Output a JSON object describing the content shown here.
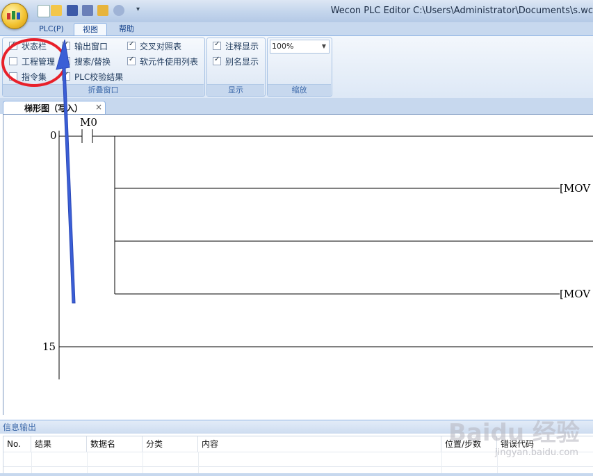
{
  "window": {
    "title": "Wecon PLC Editor  C:\\Users\\Administrator\\Documents\\s.wc"
  },
  "menu": {
    "tabs": [
      {
        "label": "PLC(P)"
      },
      {
        "label": "视图"
      },
      {
        "label": "帮助"
      }
    ]
  },
  "ribbon": {
    "fold_window": {
      "label": "折叠窗口",
      "items": [
        {
          "label": "状态栏",
          "checked": true
        },
        {
          "label": "工程管理",
          "checked": false
        },
        {
          "label": "指令集",
          "checked": false
        },
        {
          "label": "输出窗口",
          "checked": true
        },
        {
          "label": "搜索/替换",
          "checked": true
        },
        {
          "label": "PLC校验结果",
          "checked": true
        },
        {
          "label": "交叉对照表",
          "checked": true
        },
        {
          "label": "软元件使用列表",
          "checked": true
        }
      ]
    },
    "display": {
      "label": "显示",
      "items": [
        {
          "label": "注释显示",
          "checked": true
        },
        {
          "label": "别名显示",
          "checked": true
        }
      ]
    },
    "zoom": {
      "label": "缩放",
      "value": "100%"
    }
  },
  "document_tab": {
    "label": "梯形图（写入）",
    "close": "×"
  },
  "ladder": {
    "step_start": "0",
    "step_next": "15",
    "contact_label": "M0",
    "instruction_1": "[MOV",
    "instruction_2": "[MOV"
  },
  "info_output": {
    "title": "信息输出",
    "columns": [
      "No.",
      "结果",
      "数据名",
      "分类",
      "内容",
      "位置/步数",
      "错误代码"
    ]
  },
  "watermark": {
    "main": "Baidu 经验",
    "sub": "jingyan.baidu.com"
  },
  "colors": {
    "ribbon_bg": "#dde8f6",
    "accent": "#15428b",
    "annotation_red": "#e8202a",
    "arrow_blue": "#3b5fd6"
  }
}
